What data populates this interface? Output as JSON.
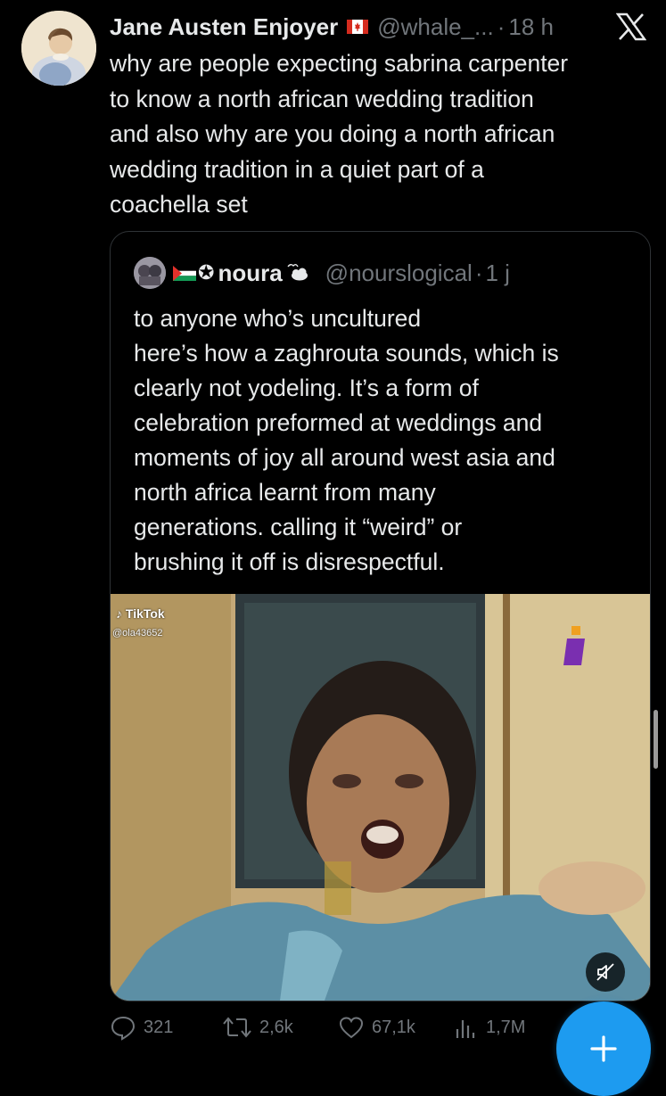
{
  "tweet": {
    "author_name": "Jane Austen Enjoyer",
    "author_flag": "canada-flag",
    "handle": "@whale_...",
    "separator": "·",
    "time": "18 h",
    "text": "why are people expecting sabrina carpenter\nto know a north african wedding tradition\nand also why are you doing a north african\nwedding tradition in a quiet part of a\ncoachella set"
  },
  "quote": {
    "author_name": "noura",
    "flag": "palestine-flag",
    "star": "✪",
    "handle": "@nourslogical",
    "separator": "·",
    "time": "1 j",
    "text": "to anyone who’s uncultured\nhere’s how a zaghrouta sounds, which is\nclearly not yodeling. It’s a form of\ncelebration preformed at weddings and\nmoments of joy all around west asia and\nnorth africa learnt from many\ngenerations. calling it “weird” or\nbrushing it off is disrespectful.",
    "video": {
      "watermark": "TikTok",
      "watermark_user": "@ola43652",
      "mute_icon": "speaker-muted-icon"
    }
  },
  "actions": {
    "replies": "321",
    "reposts": "2,6k",
    "likes": "67,1k",
    "views": "1,7M"
  },
  "colors": {
    "background": "#000000",
    "text": "#e7e9ea",
    "muted": "#71767b",
    "border": "#2f3336",
    "accent": "#1d9bf0"
  }
}
